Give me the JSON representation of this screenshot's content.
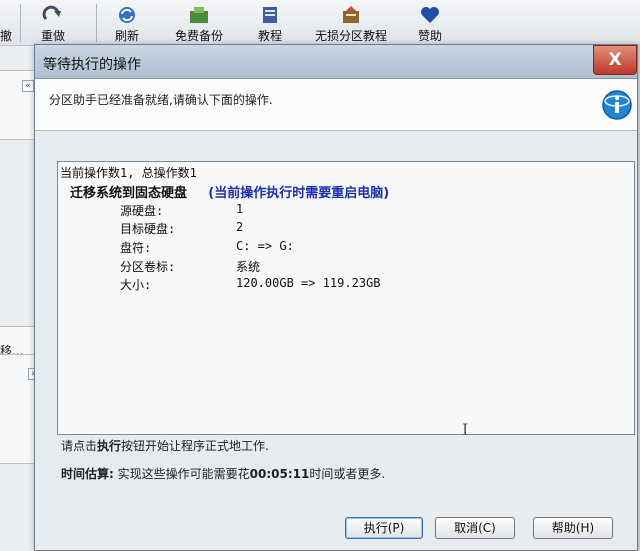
{
  "toolbar": {
    "partial_left": "撤",
    "items": [
      {
        "label": "重做",
        "icon": "redo-icon"
      },
      {
        "label": "刷新",
        "icon": "refresh-icon"
      },
      {
        "label": "免费备份",
        "icon": "backup-icon"
      },
      {
        "label": "教程",
        "icon": "tutorial-book-icon"
      },
      {
        "label": "无损分区教程",
        "icon": "partition-tutorial-icon"
      },
      {
        "label": "赞助",
        "icon": "heart-icon"
      }
    ]
  },
  "background": {
    "partial_text": "移..."
  },
  "dialog": {
    "title": "等待执行的操作",
    "close_label": "X",
    "header_text": "分区助手已经准备就绪,请确认下面的操作.",
    "operations": {
      "summary": "当前操作数1, 总操作数1",
      "operation_title": "迁移系统到固态硬盘",
      "notice": "(当前操作执行时需要重启电脑)",
      "details": [
        {
          "label": "源硬盘:",
          "value": "1"
        },
        {
          "label": "目标硬盘:",
          "value": "2"
        },
        {
          "label": "盘符:",
          "value": "C: => G:"
        },
        {
          "label": "分区卷标:",
          "value": "系统"
        },
        {
          "label": "大小:",
          "value": "120.00GB => 119.23GB"
        }
      ]
    },
    "instruction": {
      "prefix": "请点击",
      "keyword": "执行",
      "suffix": "按钮开始让程序正式地工作."
    },
    "estimate": {
      "label": "时间估算:",
      "prefix": " 实现这些操作可能需要花",
      "time": "00:05:11",
      "suffix": "时间或者更多."
    },
    "buttons": {
      "execute": "执行(P)",
      "cancel": "取消(C)",
      "help": "帮助(H)"
    }
  }
}
